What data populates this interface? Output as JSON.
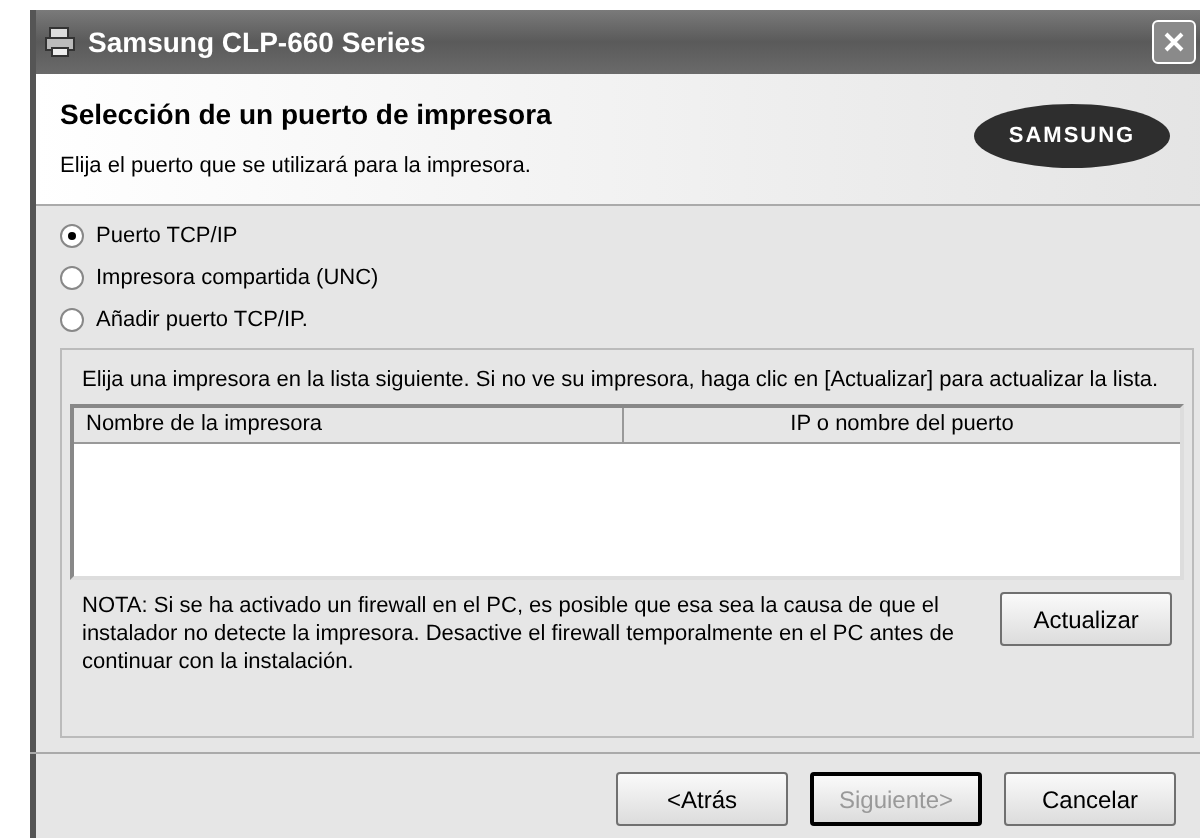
{
  "window": {
    "title": "Samsung CLP-660 Series"
  },
  "header": {
    "title": "Selección de un puerto de impresora",
    "subtitle": "Elija el puerto que se utilizará para la impresora.",
    "logo": "SAMSUNG"
  },
  "port_options": [
    {
      "label": "Puerto TCP/IP",
      "selected": true
    },
    {
      "label": "Impresora compartida (UNC)",
      "selected": false
    },
    {
      "label": "Añadir puerto TCP/IP.",
      "selected": false
    }
  ],
  "group": {
    "instructions": "Elija una impresora en la lista siguiente. Si no ve su impresora, haga clic en [Actualizar] para actualizar la lista.",
    "columns": [
      "Nombre de la impresora",
      "IP o nombre del puerto"
    ],
    "note": "NOTA: Si se ha activado un firewall en el PC, es posible que esa sea la causa de que el instalador no detecte la impresora. Desactive el firewall temporalmente en el PC antes de continuar con la instalación.",
    "refresh_button": "Actualizar"
  },
  "buttons": [
    {
      "label": "<Atrás",
      "disabled": false
    },
    {
      "label": "Siguiente>",
      "disabled": true
    },
    {
      "label": "Cancelar",
      "disabled": false
    }
  ]
}
